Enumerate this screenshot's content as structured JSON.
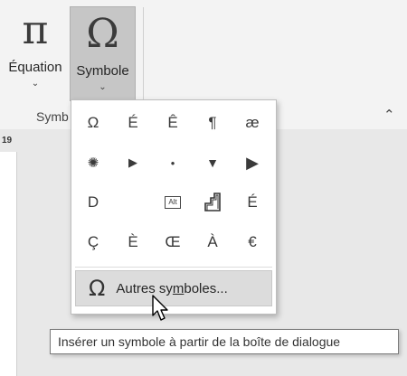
{
  "ribbon": {
    "equation": {
      "icon": "π",
      "label": "Équation",
      "chevron": "⌄"
    },
    "symbol": {
      "icon": "Ω",
      "label": "Symbole",
      "chevron": "⌄"
    },
    "group_label": "Symb",
    "collapse_icon": "⌃"
  },
  "ruler": {
    "number": "19"
  },
  "panel": {
    "symbols": [
      [
        "Ω",
        "É",
        "Ê",
        "¶",
        "æ"
      ],
      [
        "✺",
        "▶",
        "•",
        "▼",
        "▶"
      ],
      [
        "D",
        "",
        "Alt",
        "stair",
        "É"
      ],
      [
        "Ç",
        "È",
        "Œ",
        "À",
        "€"
      ]
    ],
    "more": {
      "icon": "Ω",
      "label_pre": "Autres sy",
      "label_underline": "m",
      "label_post": "boles..."
    }
  },
  "tooltip": {
    "text": "Insérer un symbole à partir de la boîte de dialogue"
  }
}
